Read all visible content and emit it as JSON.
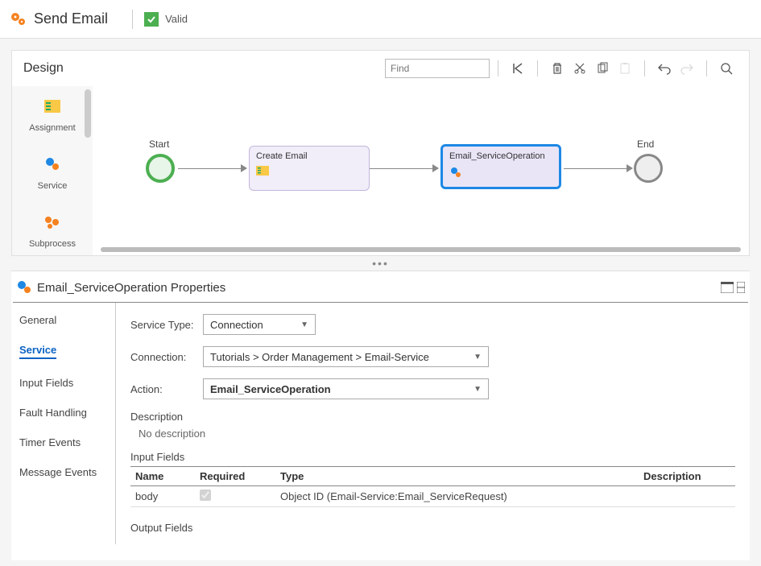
{
  "header": {
    "title": "Send Email",
    "valid_label": "Valid"
  },
  "design": {
    "title": "Design",
    "find_placeholder": "Find"
  },
  "palette": {
    "items": [
      {
        "label": "Assignment"
      },
      {
        "label": "Service"
      },
      {
        "label": "Subprocess"
      }
    ]
  },
  "flow": {
    "start_label": "Start",
    "end_label": "End",
    "nodes": [
      {
        "label": "Create Email"
      },
      {
        "label": "Email_ServiceOperation"
      }
    ]
  },
  "properties": {
    "title": "Email_ServiceOperation Properties",
    "tabs": [
      "General",
      "Service",
      "Input Fields",
      "Fault Handling",
      "Timer Events",
      "Message Events"
    ],
    "active_tab": "Service",
    "form": {
      "service_type_label": "Service Type:",
      "service_type_value": "Connection",
      "connection_label": "Connection:",
      "connection_value": "Tutorials > Order Management > Email-Service",
      "action_label": "Action:",
      "action_value": "Email_ServiceOperation",
      "description_label": "Description",
      "description_value": "No description",
      "input_fields_label": "Input Fields",
      "output_fields_label": "Output Fields",
      "table": {
        "headers": [
          "Name",
          "Required",
          "Type",
          "Description"
        ],
        "rows": [
          {
            "name": "body",
            "required": true,
            "type": "Object ID (Email-Service:Email_ServiceRequest)",
            "description": ""
          }
        ]
      }
    }
  }
}
